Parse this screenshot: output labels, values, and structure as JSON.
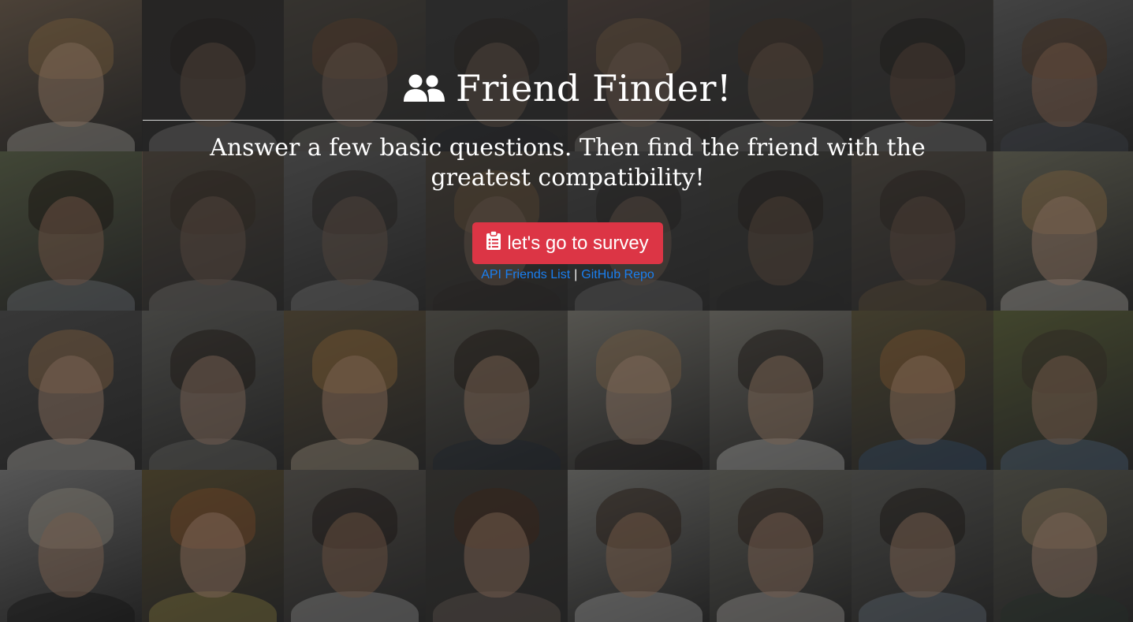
{
  "header": {
    "title": "Friend Finder!",
    "title_icon": "users-icon"
  },
  "intro": {
    "subtitle": "Answer a few basic questions. Then find the friend with the greatest compatibility!"
  },
  "survey_button": {
    "label": "let's go to survey",
    "icon": "clipboard-list-icon",
    "color": "#dc3545"
  },
  "links": {
    "api_friends": "API Friends List",
    "separator": "|",
    "github_repo": "GitHub Repo",
    "color": "#1a7ff0"
  },
  "background": {
    "description_icon": "portrait-mosaic",
    "tiles": [
      {
        "skin": "#c9a58a",
        "hair": "#b08a5a",
        "shirt": "#d9d4cc",
        "bg": "#7a6a5a"
      },
      {
        "skin": "#a8856c",
        "hair": "#2a2520",
        "shirt": "#e6e6e6",
        "bg": "#3e3a38"
      },
      {
        "skin": "#c8a08a",
        "hair": "#a8683c",
        "shirt": "#cfc9c0",
        "bg": "#6a6256"
      },
      {
        "skin": "#b28f78",
        "hair": "#3a2e26",
        "shirt": "#2e3440",
        "bg": "#4a4a4a"
      },
      {
        "skin": "#c8a28a",
        "hair": "#c89a68",
        "shirt": "#e0dcd4",
        "bg": "#7a6258"
      },
      {
        "skin": "#ad8a70",
        "hair": "#6a4a30",
        "shirt": "#cfcfcf",
        "bg": "#585450"
      },
      {
        "skin": "#9a7058",
        "hair": "#1e1a18",
        "shirt": "#e6e6e6",
        "bg": "#5a5650"
      },
      {
        "skin": "#a88068",
        "hair": "#6a4a32",
        "shirt": "#58606a",
        "bg": "#6c6c6c"
      },
      {
        "skin": "#a8806a",
        "hair": "#2a211c",
        "shirt": "#9aa0a8",
        "bg": "#6a7258"
      },
      {
        "skin": "#b48e78",
        "hair": "#4a3828",
        "shirt": "#e4e0da",
        "bg": "#7a6a58"
      },
      {
        "skin": "#b08e78",
        "hair": "#2e2620",
        "shirt": "#e8e8e8",
        "bg": "#8a8a8a"
      },
      {
        "skin": "#c09c84",
        "hair": "#b88a58",
        "shirt": "#3a3430",
        "bg": "#6a5e50"
      },
      {
        "skin": "#b4927a",
        "hair": "#2a2624",
        "shirt": "#c0c0c4",
        "bg": "#6a6a6a"
      },
      {
        "skin": "#a07c64",
        "hair": "#2a1e18",
        "shirt": "#3a3a3a",
        "bg": "#5a5a54"
      },
      {
        "skin": "#a88068",
        "hair": "#3a2a22",
        "shirt": "#b08a5a",
        "bg": "#7a6e60"
      },
      {
        "skin": "#c8a48c",
        "hair": "#b8905e",
        "shirt": "#e6e2dc",
        "bg": "#7a7a6a"
      },
      {
        "skin": "#c4a088",
        "hair": "#b88a5e",
        "shirt": "#e8e4de",
        "bg": "#5a5a5a"
      },
      {
        "skin": "#b69682",
        "hair": "#2e2620",
        "shirt": "#8a8a86",
        "bg": "#6e6e6a"
      },
      {
        "skin": "#c49c82",
        "hair": "#b8884e",
        "shirt": "#d8c8b0",
        "bg": "#6a5e48"
      },
      {
        "skin": "#b8967e",
        "hair": "#2e2620",
        "shirt": "#2e3a48",
        "bg": "#6a6860"
      },
      {
        "skin": "#c8a890",
        "hair": "#b08c66",
        "shirt": "#2e2a2a",
        "bg": "#8a8880"
      },
      {
        "skin": "#bc9a82",
        "hair": "#2a2420",
        "shirt": "#ecebe8",
        "bg": "#8a8880"
      },
      {
        "skin": "#c8a084",
        "hair": "#b07a48",
        "shirt": "#4a6a90",
        "bg": "#6a6248"
      },
      {
        "skin": "#ae8a72",
        "hair": "#4a4038",
        "shirt": "#6a88a8",
        "bg": "#6a7048"
      },
      {
        "skin": "#b8947c",
        "hair": "#c0b8a8",
        "shirt": "#1e1e1e",
        "bg": "#8a8a8a"
      },
      {
        "skin": "#c8a08a",
        "hair": "#a8683c",
        "shirt": "#b8a858",
        "bg": "#6a5e40"
      },
      {
        "skin": "#a07c64",
        "hair": "#2a2220",
        "shirt": "#c8c8c8",
        "bg": "#6a6660"
      },
      {
        "skin": "#b8927a",
        "hair": "#5a3a28",
        "shirt": "#8a7a70",
        "bg": "#4a4844"
      },
      {
        "skin": "#b08a70",
        "hair": "#3a2a20",
        "shirt": "#d8d8d8",
        "bg": "#8a8a86"
      },
      {
        "skin": "#b4907a",
        "hair": "#3a2a22",
        "shirt": "#e0dcd8",
        "bg": "#7a7a72"
      },
      {
        "skin": "#b8947c",
        "hair": "#2a2420",
        "shirt": "#8a9aa8",
        "bg": "#6a6a66"
      },
      {
        "skin": "#c4a08a",
        "hair": "#b89a74",
        "shirt": "#3a4a40",
        "bg": "#6a6a60"
      }
    ]
  }
}
